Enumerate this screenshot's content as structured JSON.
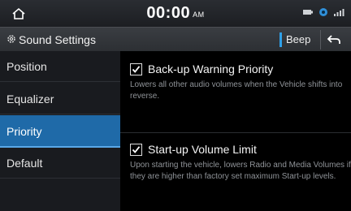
{
  "status_bar": {
    "time": "00:00",
    "ampm": "AM"
  },
  "title_bar": {
    "title": "Sound Settings",
    "beep_label": "Beep"
  },
  "sidebar": {
    "items": [
      {
        "label": "Position",
        "active": false
      },
      {
        "label": "Equalizer",
        "active": false
      },
      {
        "label": "Priority",
        "active": true
      },
      {
        "label": "Default",
        "active": false
      }
    ]
  },
  "settings": [
    {
      "label": "Back-up Warning Priority",
      "checked": true,
      "description": "Lowers all other audio volumes when the Vehicle shifts into reverse."
    },
    {
      "label": "Start-up Volume Limit",
      "checked": true,
      "description": "Upon starting the vehicle, lowers Radio and Media Volumes if they are higher than factory set maximum Start-up levels."
    }
  ],
  "colors": {
    "accent": "#1f6aa8",
    "beep_indicator": "#2fa0e8"
  }
}
